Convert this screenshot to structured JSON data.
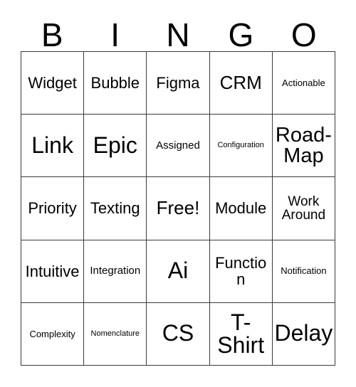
{
  "card": {
    "title": "BINGO",
    "header_letters": [
      "B",
      "I",
      "N",
      "G",
      "O"
    ],
    "grid_size": "5x5",
    "free_space": "Free!",
    "colors": {
      "background": "#ffffff",
      "text": "#000000",
      "grid_line": "#3a3a3a"
    },
    "rows": [
      {
        "cells": [
          {
            "label": "Widget",
            "size": "md"
          },
          {
            "label": "Bubble",
            "size": "md"
          },
          {
            "label": "Figma",
            "size": "md"
          },
          {
            "label": "CRM",
            "size": "lg"
          },
          {
            "label": "Actionable",
            "size": "xxs"
          }
        ]
      },
      {
        "cells": [
          {
            "label": "Link",
            "size": "xxl"
          },
          {
            "label": "Epic",
            "size": "xxl"
          },
          {
            "label": "Assigned",
            "size": "xs"
          },
          {
            "label": "Configuration",
            "size": "tiny"
          },
          {
            "label": "Road-Map",
            "size": "xl"
          }
        ]
      },
      {
        "cells": [
          {
            "label": "Priority",
            "size": "md"
          },
          {
            "label": "Texting",
            "size": "md"
          },
          {
            "label": "Free!",
            "size": "lg"
          },
          {
            "label": "Module",
            "size": "md"
          },
          {
            "label": "Work Around",
            "size": "sm"
          }
        ]
      },
      {
        "cells": [
          {
            "label": "Intuitive",
            "size": "md"
          },
          {
            "label": "Integration",
            "size": "xs"
          },
          {
            "label": "Ai",
            "size": "xxl"
          },
          {
            "label": "Function",
            "size": "md"
          },
          {
            "label": "Notification",
            "size": "xxs"
          }
        ]
      },
      {
        "cells": [
          {
            "label": "Complexity",
            "size": "xxs"
          },
          {
            "label": "Nomenclature",
            "size": "tiny"
          },
          {
            "label": "CS",
            "size": "xxl"
          },
          {
            "label": "T-Shirt",
            "size": "xxl"
          },
          {
            "label": "Delay",
            "size": "xxl"
          }
        ]
      }
    ]
  }
}
